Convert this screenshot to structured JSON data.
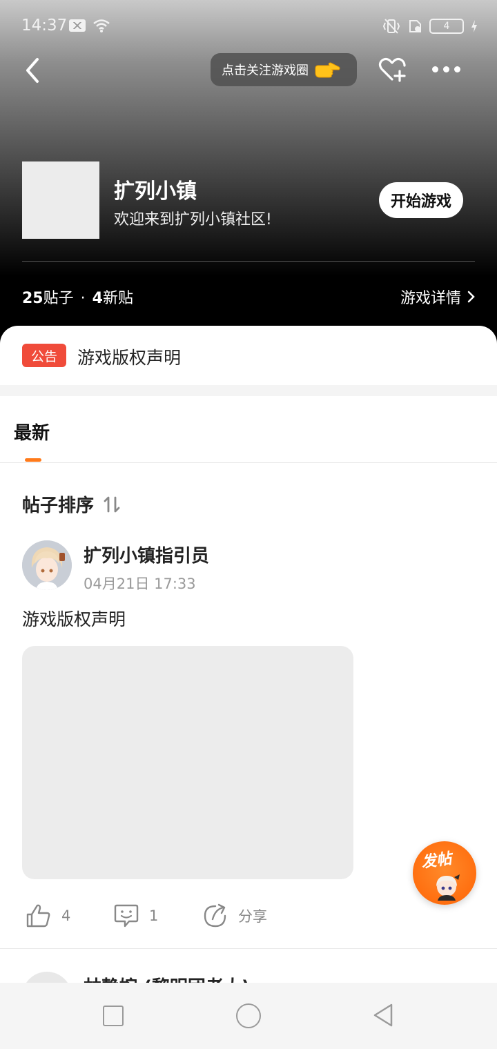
{
  "status_bar": {
    "time": "14:37",
    "battery": "4"
  },
  "top_nav": {
    "follow_label": "点击关注游戏圈"
  },
  "game": {
    "title": "扩列小镇",
    "subtitle": "欢迎来到扩列小镇社区!",
    "play_label": "开始游戏",
    "posts_count": "25",
    "posts_label": "贴子",
    "separator": "·",
    "new_count": "4",
    "new_label": "新贴",
    "details_label": "游戏详情"
  },
  "notice": {
    "badge": "公告",
    "text": "游戏版权声明"
  },
  "tabs": {
    "latest": "最新"
  },
  "sort": {
    "label": "帖子排序"
  },
  "post": {
    "author": "扩列小镇指引员",
    "time": "04月21日 17:33",
    "text": "游戏版权声明",
    "likes": "4",
    "comments": "1",
    "share_label": "分享"
  },
  "next_post": {
    "author": "林静婉 (黎明团老大)"
  },
  "fab": {
    "label": "发帖"
  },
  "colors": {
    "accent": "#ff7a1a",
    "notice_badge": "#f04b3a",
    "fab": "#ff6f10"
  }
}
